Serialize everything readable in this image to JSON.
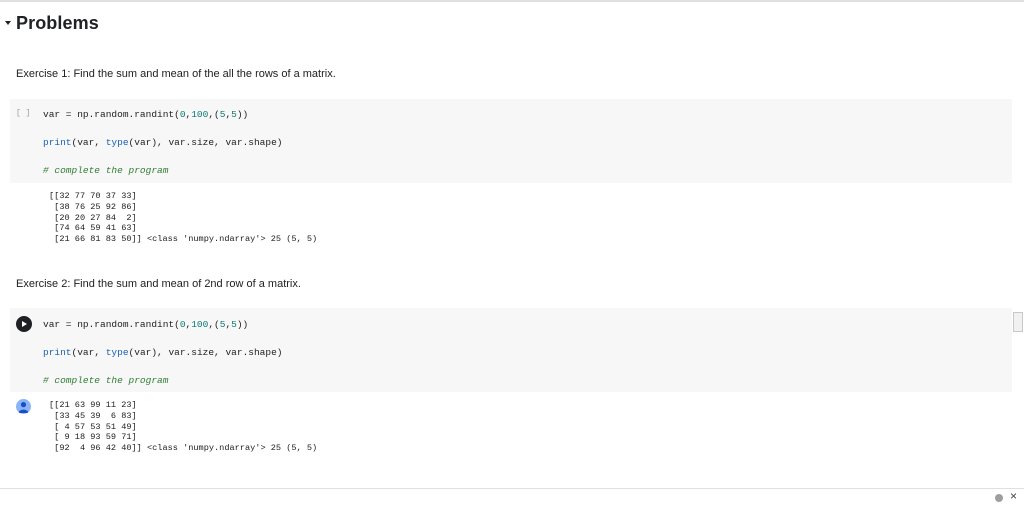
{
  "section": {
    "title": "Problems"
  },
  "exercise1": {
    "text": "Exercise 1: Find the sum and mean of the all the rows of a matrix.",
    "prompt": "[ ]",
    "code": {
      "line1": [
        "var = np.random.randint(",
        "0",
        ",",
        "100",
        ",(",
        "5",
        ",",
        "5",
        "))"
      ],
      "line2": [
        "print",
        "(var, ",
        "type",
        "(var), var.size, var.shape)"
      ],
      "comment": "# complete the program"
    },
    "output": "[[32 77 70 37 33]\n [38 76 25 92 86]\n [20 20 27 84  2]\n [74 64 59 41 63]\n [21 66 81 83 50]] <class 'numpy.ndarray'> 25 (5, 5)"
  },
  "exercise2": {
    "text": "Exercise 2: Find the sum and mean of 2nd row of a matrix.",
    "code": {
      "line1": [
        "var = np.random.randint(",
        "0",
        ",",
        "100",
        ",(",
        "5",
        ",",
        "5",
        "))"
      ],
      "line2": [
        "print",
        "(var, ",
        "type",
        "(var), var.size, var.shape)"
      ],
      "comment": "# complete the program"
    },
    "output": "[[21 63 99 11 23]\n [33 45 39  6 83]\n [ 4 57 53 51 49]\n [ 9 18 93 59 71]\n [92  4 96 42 40]] <class 'numpy.ndarray'> 25 (5, 5)"
  },
  "footer": {
    "close_label": "×"
  },
  "icons": {
    "caret": "caret-down-icon",
    "run": "play-icon",
    "output": "output-avatar-icon",
    "close": "close-icon",
    "status": "status-dot-icon"
  },
  "colors": {
    "cell_bg": "#f7f7f7",
    "number": "#0b7a75",
    "builtin": "#1a5fb4",
    "comment": "#2e7d32"
  }
}
